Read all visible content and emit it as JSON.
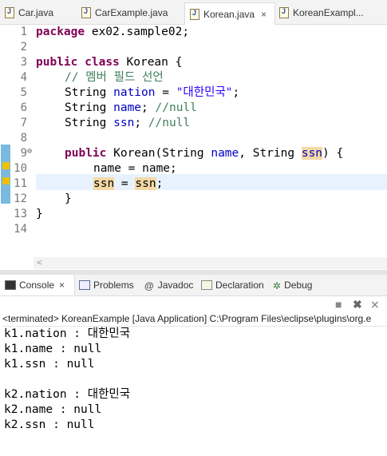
{
  "editor_tabs": [
    {
      "label": "Car.java",
      "active": false
    },
    {
      "label": "CarExample.java",
      "active": false
    },
    {
      "label": "Korean.java",
      "active": true,
      "close": "×"
    },
    {
      "label": "KoreanExampl...",
      "active": false
    }
  ],
  "line_numbers": [
    "1",
    "2",
    "3",
    "4",
    "5",
    "6",
    "7",
    "8",
    "9",
    "10",
    "11",
    "12",
    "13",
    "14"
  ],
  "code": {
    "l1_kw": "package",
    "l1_rest": " ex02.sample02;",
    "l3_kw1": "public",
    "l3_kw2": "class",
    "l3_rest": " Korean {",
    "l4_comment": "// 멤버 필드 선언",
    "l5_type": "String ",
    "l5_field": "nation",
    "l5_eq": " = ",
    "l5_str": "\"대한민국\"",
    "l5_end": ";",
    "l6_type": "String ",
    "l6_field": "name",
    "l6_end": "; ",
    "l6_comment": "//null",
    "l7_type": "String ",
    "l7_field": "ssn",
    "l7_end": "; ",
    "l7_comment": "//null",
    "l9_kw": "public",
    "l9_a": " Korean(String ",
    "l9_p1": "name",
    "l9_b": ", String ",
    "l9_p2": "ssn",
    "l9_c": ") {",
    "l10": "name = name;",
    "l11_a": "ssn",
    "l11_b": " = ",
    "l11_c": "ssn",
    "l11_d": ";",
    "l12": "}",
    "l13": "}"
  },
  "view_tabs": {
    "console": "Console",
    "console_close": "×",
    "problems": "Problems",
    "javadoc": "Javadoc",
    "javadoc_icon": "@",
    "declaration": "Declaration",
    "debug": "Debug"
  },
  "console_header": "<terminated> KoreanExample [Java Application] C:\\Program Files\\eclipse\\plugins\\org.e",
  "console_output": [
    "k1.nation : 대한민국",
    "k1.name : null",
    "k1.ssn : null",
    "",
    "k2.nation : 대한민국",
    "k2.name : null",
    "k2.ssn : null"
  ],
  "icons": {
    "java_file": "java-file-icon",
    "terminate": "terminate-icon",
    "remove_launch": "remove-launch-icon",
    "remove_all": "remove-all-icon"
  },
  "colors": {
    "keyword": "#7f0055",
    "field": "#0000c0",
    "string": "#2a00ff",
    "comment": "#3f7f5f",
    "occurrence_highlight": "#f2d9a6",
    "current_line": "#e8f2fe"
  }
}
